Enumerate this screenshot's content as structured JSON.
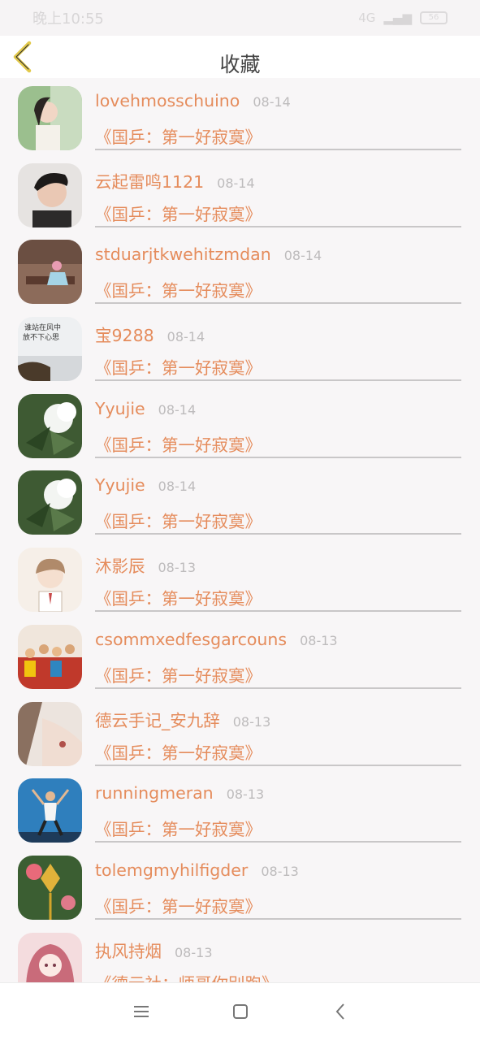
{
  "status_bar": {
    "time": "晚上10:55",
    "signal_text": "4G",
    "battery": "56"
  },
  "header": {
    "title": "收藏",
    "back_icon": "chevron-left-icon",
    "accent": "#e2c94a"
  },
  "colors": {
    "name": "#e58c5c",
    "date": "#bdbbbc",
    "background": "#f8f6f7"
  },
  "items": [
    {
      "name": "lovehmosschuino",
      "date": "08-14",
      "work": "《国乒：第一好寂寞》",
      "avatar": "girl-portrait-green"
    },
    {
      "name": "云起雷鸣1121",
      "date": "08-14",
      "work": "《国乒：第一好寂寞》",
      "avatar": "young-man-portrait"
    },
    {
      "name": "stduarjtkwehitzmdan",
      "date": "08-14",
      "work": "《国乒：第一好寂寞》",
      "avatar": "girl-on-bench"
    },
    {
      "name": "宝9288",
      "date": "08-14",
      "work": "《国乒：第一好寂寞》",
      "avatar": "seaside-text-image"
    },
    {
      "name": "Yyujie",
      "date": "08-14",
      "work": "《国乒：第一好寂寞》",
      "avatar": "white-flower"
    },
    {
      "name": "Yyujie",
      "date": "08-14",
      "work": "《国乒：第一好寂寞》",
      "avatar": "white-flower"
    },
    {
      "name": "沐影辰",
      "date": "08-13",
      "work": "《国乒：第一好寂寞》",
      "avatar": "anime-boy"
    },
    {
      "name": "csommxedfesgarcouns",
      "date": "08-13",
      "work": "《国乒：第一好寂寞》",
      "avatar": "group-photo"
    },
    {
      "name": "德云手记_安九辞",
      "date": "08-13",
      "work": "《国乒：第一好寂寞》",
      "avatar": "shoulder-tattoo"
    },
    {
      "name": "runningmeran",
      "date": "08-13",
      "work": "《国乒：第一好寂寞》",
      "avatar": "dancer-blue-wall"
    },
    {
      "name": "tolemgmyhilfigder",
      "date": "08-13",
      "work": "《国乒：第一好寂寞》",
      "avatar": "chinese-knot"
    },
    {
      "name": "执风持烟",
      "date": "08-13",
      "work": "《德云社：师哥你别跑》",
      "avatar": "anime-girl-pink"
    }
  ],
  "nav": {
    "menu_icon": "menu-icon",
    "home_icon": "square-home-icon",
    "back_icon": "triangle-back-icon"
  }
}
